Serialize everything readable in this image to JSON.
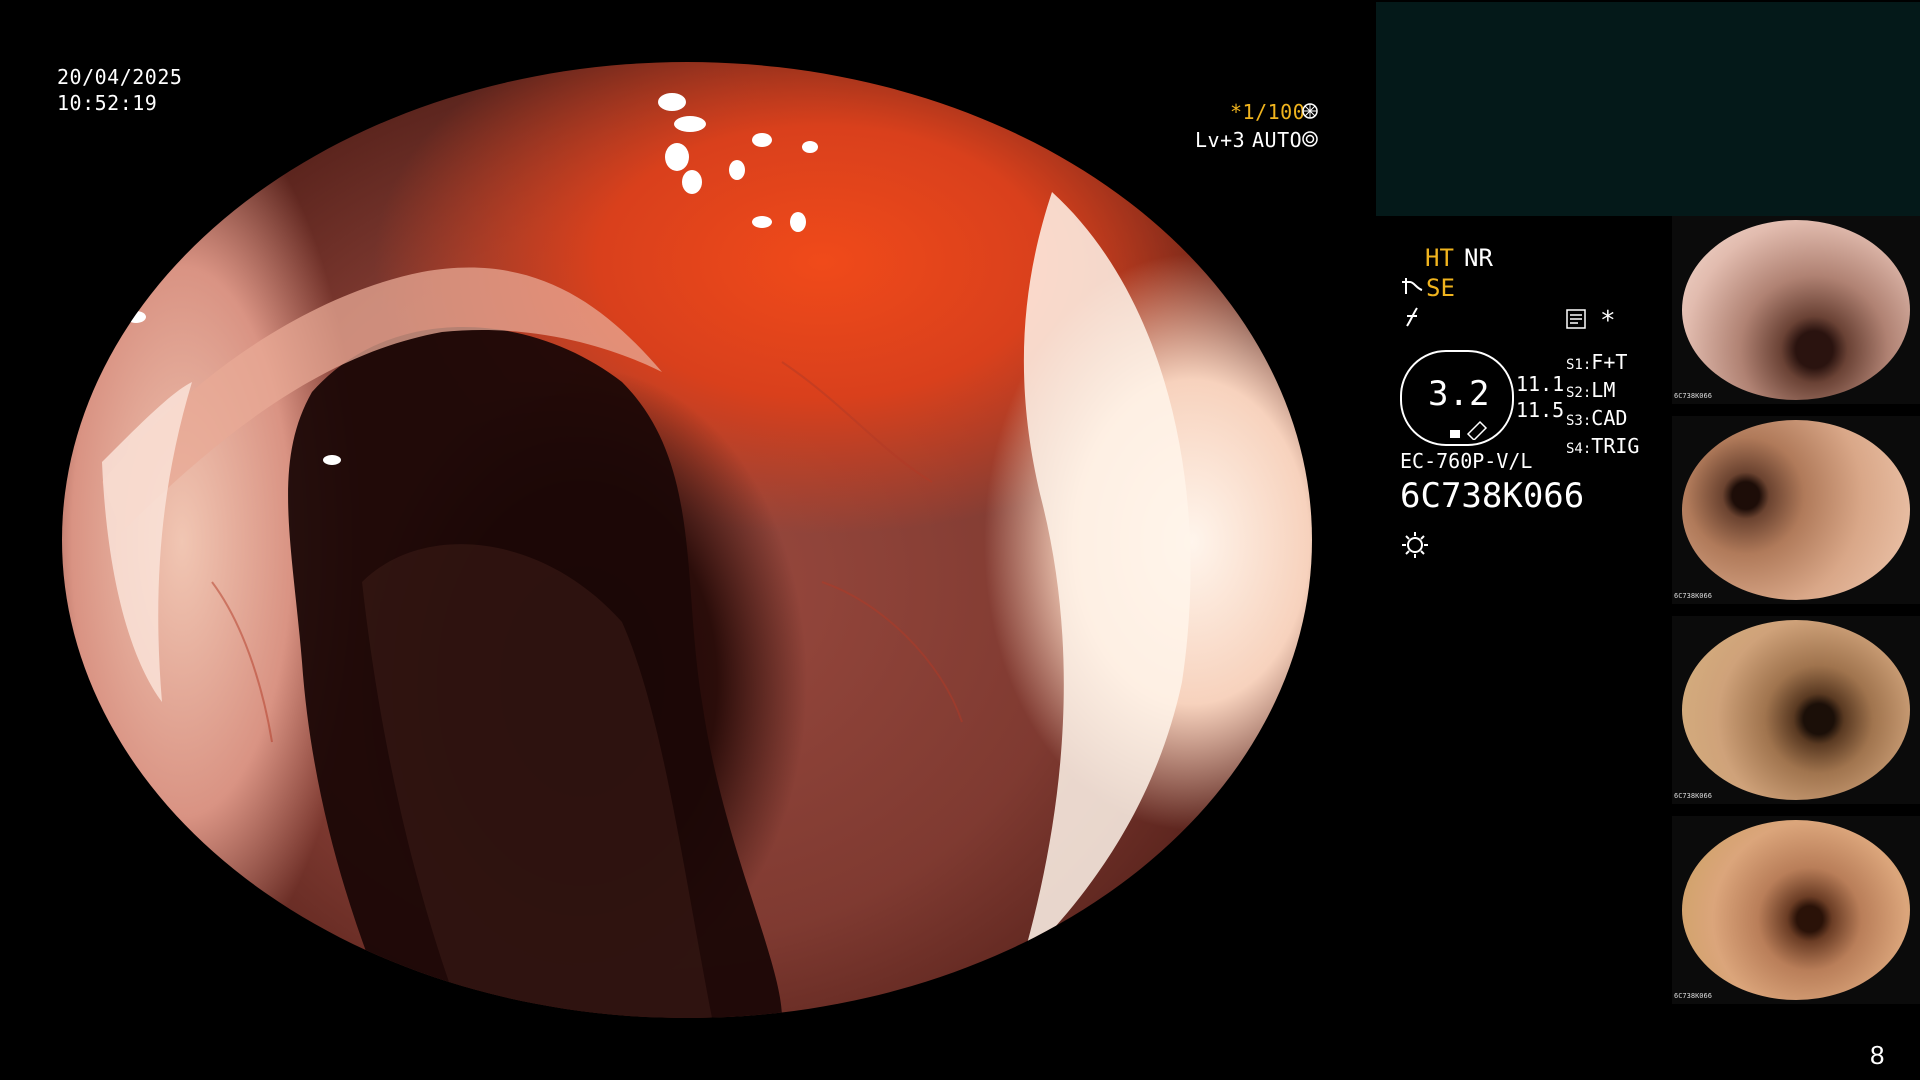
{
  "overlay": {
    "date": "20/04/2025",
    "time": "10:52:19",
    "shutter": "*1/100",
    "level": "Lv+3",
    "mode": "AUTO"
  },
  "settings": {
    "ht": "HT",
    "nr": "NR",
    "se": "SE",
    "zoom_value": "3.2",
    "scale_top": "11.1",
    "scale_bottom": "11.5",
    "scope_model": "EC-760P-V/L",
    "serial": "6C738K066",
    "switches": [
      {
        "key": "S1",
        "value": "F+T"
      },
      {
        "key": "S2",
        "value": "LM"
      },
      {
        "key": "S3",
        "value": "CAD"
      },
      {
        "key": "S4",
        "value": "TRIG"
      }
    ],
    "star": "*"
  },
  "thumbnails": [
    {
      "label": "6C738K066"
    },
    {
      "label": "6C738K066"
    },
    {
      "label": "6C738K066"
    },
    {
      "label": "6C738K066"
    }
  ],
  "page_number": "8",
  "icons": {
    "shutter": "aperture-icon",
    "auto": "iris-icon",
    "se": "structure-enhance-icon",
    "flash": "freeze-icon",
    "memory": "memory-card-icon",
    "light": "light-source-icon"
  }
}
